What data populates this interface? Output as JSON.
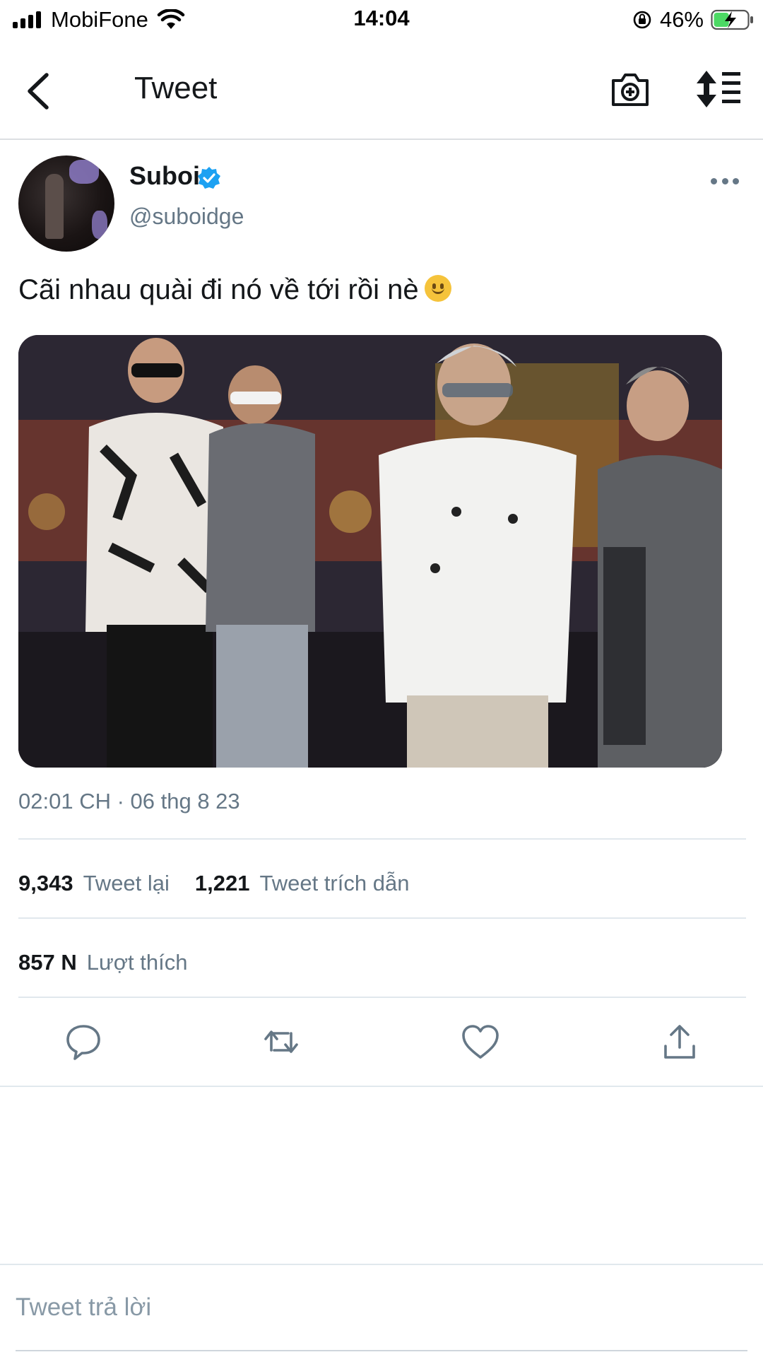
{
  "status_bar": {
    "carrier": "MobiFone",
    "time": "14:04",
    "battery_percent": "46%",
    "battery_level": 0.46
  },
  "header": {
    "title": "Tweet"
  },
  "tweet": {
    "author_name": "Suboi",
    "author_handle": "@suboidge",
    "verified": true,
    "text": "Cãi nhau quài đi nó về tới rồi nè",
    "emoji": "slightly-smiling-face",
    "timestamp": "02:01 CH · 06 thg 8 23",
    "retweet_count": "9,343",
    "retweet_label": "Tweet lại",
    "quote_count": "1,221",
    "quote_label": "Tweet trích dẫn",
    "like_count": "857 N",
    "like_label": "Lượt thích"
  },
  "reply": {
    "placeholder": "Tweet trả lời"
  },
  "colors": {
    "accent": "#1da1f2",
    "secondary_text": "#657786",
    "divider": "#e1e8ed"
  }
}
